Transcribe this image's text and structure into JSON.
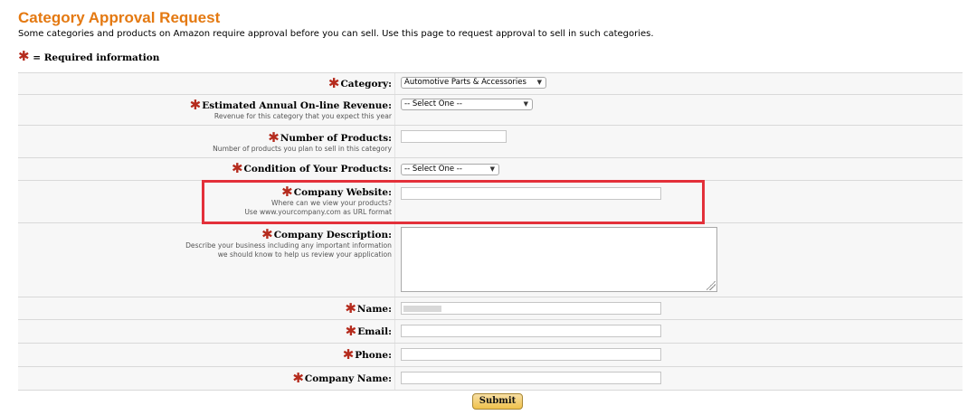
{
  "header": {
    "title": "Category Approval Request",
    "intro": "Some categories and products on Amazon require approval before you can sell. Use this page to request approval to sell in such categories.",
    "required_star": "✱",
    "required_legend": "= Required information"
  },
  "form": {
    "category": {
      "label": "Category:",
      "value": "Automotive Parts & Accessories"
    },
    "revenue": {
      "label": "Estimated Annual On-line Revenue:",
      "hint": "Revenue for this category that you expect this year",
      "value": "-- Select One --"
    },
    "num_products": {
      "label": "Number of Products:",
      "hint": "Number of products you plan to sell in this category",
      "value": ""
    },
    "condition": {
      "label": "Condition of Your Products:",
      "value": "-- Select One --"
    },
    "website": {
      "label": "Company Website:",
      "hint1": "Where can we view your products?",
      "hint2": "Use www.yourcompany.com as URL format",
      "value": ""
    },
    "description": {
      "label": "Company Description:",
      "hint1": "Describe your business including any important information",
      "hint2": "we should know to help us review your application",
      "value": ""
    },
    "name": {
      "label": "Name:",
      "value": ""
    },
    "email": {
      "label": "Email:",
      "value": ""
    },
    "phone": {
      "label": "Phone:",
      "value": ""
    },
    "company_name": {
      "label": "Company Name:",
      "value": ""
    }
  },
  "submit_label": "Submit",
  "colors": {
    "title": "#e47911",
    "required_star": "#b52b1d",
    "highlight": "#e3303a",
    "submit_bg": "#f0c14b"
  }
}
